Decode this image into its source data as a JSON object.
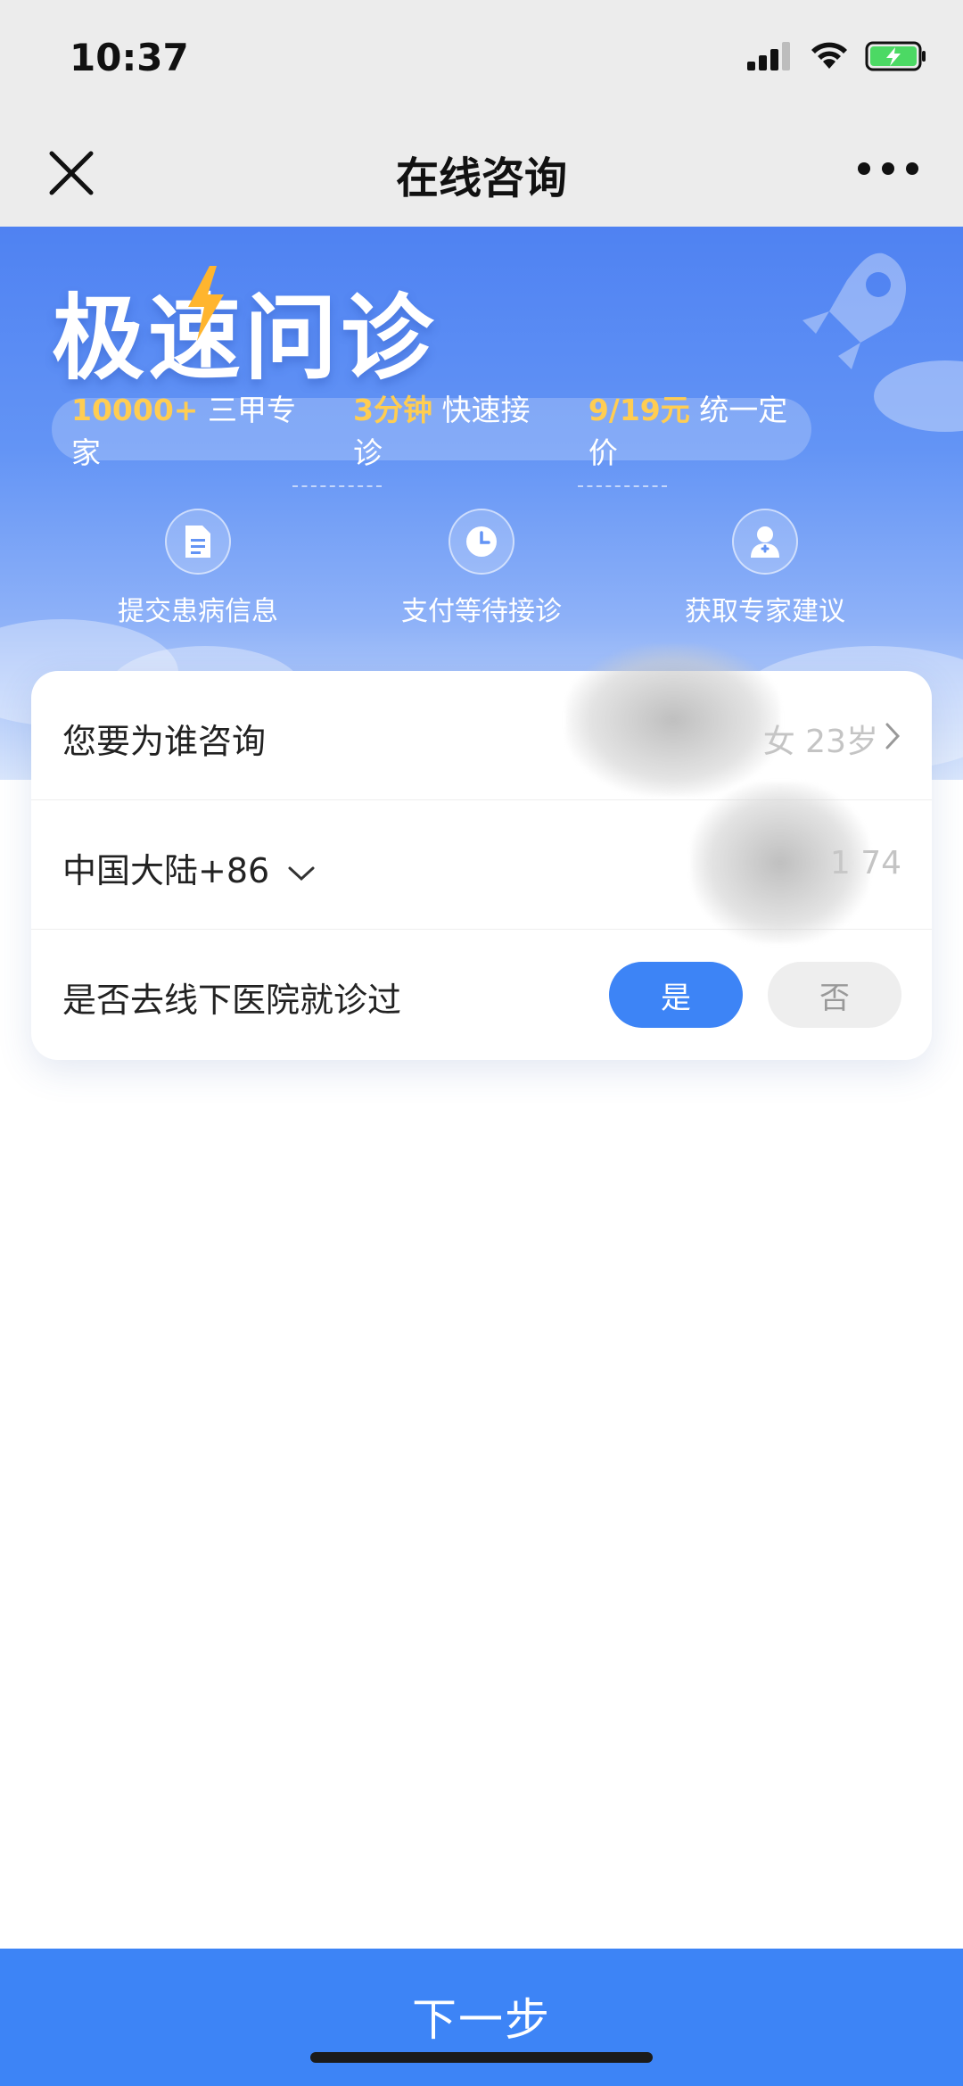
{
  "status_bar": {
    "time": "10:37"
  },
  "nav": {
    "title": "在线咨询"
  },
  "hero": {
    "title": "极速问诊",
    "stats": [
      {
        "highlight": "10000+",
        "text": "三甲专家"
      },
      {
        "highlight": "3分钟",
        "text": "快速接诊"
      },
      {
        "highlight": "9/19元",
        "text": "统一定价"
      }
    ],
    "steps": [
      {
        "label": "提交患病信息",
        "icon": "document-icon"
      },
      {
        "label": "支付等待接诊",
        "icon": "clock-icon"
      },
      {
        "label": "获取专家建议",
        "icon": "doctor-icon"
      }
    ]
  },
  "form": {
    "consult_for": {
      "label": "您要为谁咨询",
      "value": "女 23岁"
    },
    "phone": {
      "region_label": "中国大陆+86",
      "value": "1 74"
    },
    "visited_hospital": {
      "label": "是否去线下医院就诊过",
      "yes_label": "是",
      "no_label": "否",
      "selected": "是"
    }
  },
  "footer": {
    "next_label": "下一步"
  },
  "colors": {
    "primary": "#3d84f6",
    "highlight": "#ffcd52",
    "hero_top": "#4f82f2"
  }
}
